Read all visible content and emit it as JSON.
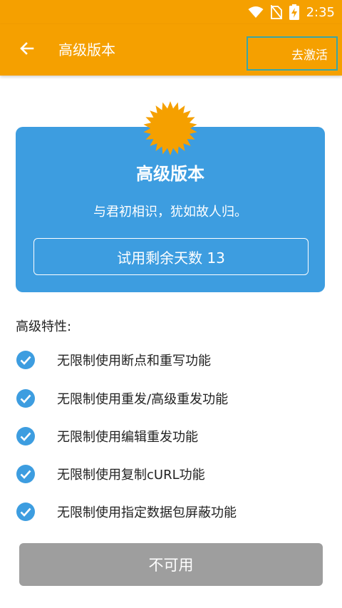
{
  "status_bar": {
    "time": "2:35",
    "icons": [
      "wifi-icon",
      "no-sim-icon",
      "battery-charging-icon"
    ]
  },
  "app_bar": {
    "title": "高级版本",
    "back_icon": "arrow-left-icon",
    "activate_label": "去激活"
  },
  "card": {
    "title": "高级版本",
    "subtitle": "与君初相识，犹如故人归。",
    "trial_text": "试用剩余天数 13",
    "badge_icon": "starburst-badge-icon",
    "background": "#3d9de0"
  },
  "features": {
    "heading": "高级特性:",
    "items": [
      {
        "label": "无限制使用断点和重写功能"
      },
      {
        "label": "无限制使用重发/高级重发功能"
      },
      {
        "label": "无限制使用编辑重发功能"
      },
      {
        "label": "无限制使用复制cURL功能"
      },
      {
        "label": "无限制使用指定数据包屏蔽功能"
      }
    ]
  },
  "footer": {
    "button_label": "不可用"
  },
  "colors": {
    "accent": "#f5a000",
    "card": "#3d9de0",
    "check": "#3d9de0",
    "disabled": "#9e9e9e"
  }
}
